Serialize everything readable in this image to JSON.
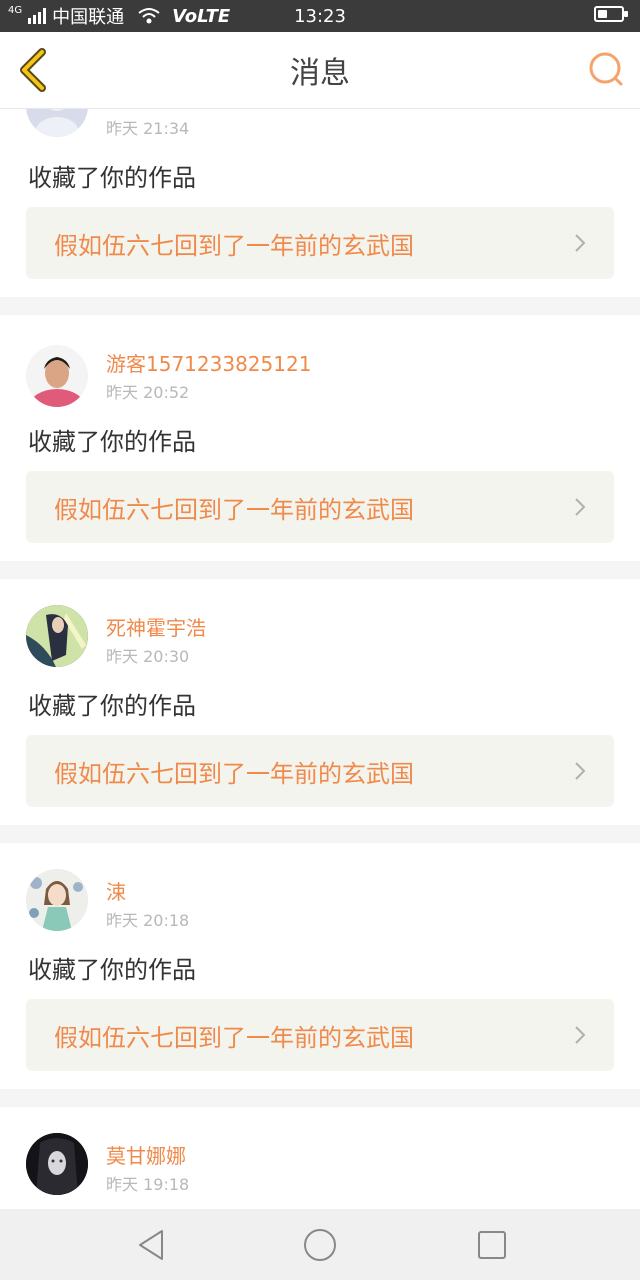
{
  "status_bar": {
    "network": "4G",
    "carrier": "中国联通",
    "volte": "VoLTE",
    "time": "13:23",
    "battery_level": 0.4
  },
  "header": {
    "title": "消息",
    "back_icon": "chevron-left-icon",
    "search_icon": "search-icon",
    "accent_color": "#f5a623"
  },
  "messages": [
    {
      "username": "",
      "time": "昨天 21:34",
      "action": "收藏了你的作品",
      "work_title": "假如伍六七回到了一年前的玄武国"
    },
    {
      "username": "游客1571233825121",
      "time": "昨天 20:52",
      "action": "收藏了你的作品",
      "work_title": "假如伍六七回到了一年前的玄武国"
    },
    {
      "username": "死神霍宇浩",
      "time": "昨天 20:30",
      "action": "收藏了你的作品",
      "work_title": "假如伍六七回到了一年前的玄武国"
    },
    {
      "username": "涑",
      "time": "昨天 20:18",
      "action": "收藏了你的作品",
      "work_title": "假如伍六七回到了一年前的玄武国"
    },
    {
      "username": "莫甘娜娜",
      "time": "昨天 19:18",
      "action": "",
      "work_title": ""
    }
  ],
  "colors": {
    "username": "#f08a4b",
    "work_title": "#f08a4b",
    "time": "#b8b8b8"
  },
  "nav_bar": {
    "back_icon": "triangle-back-icon",
    "home_icon": "circle-home-icon",
    "recents_icon": "square-recents-icon"
  }
}
